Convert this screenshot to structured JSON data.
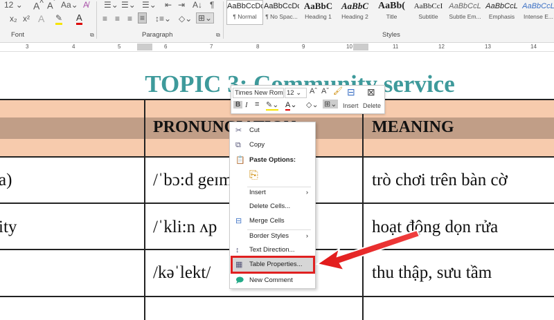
{
  "ribbon": {
    "font_size": "12",
    "groups": {
      "font": "Font",
      "paragraph": "Paragraph",
      "styles": "Styles"
    },
    "styles": [
      {
        "preview": "AaBbCcDc",
        "name": "¶ Normal",
        "selected": true
      },
      {
        "preview": "AaBbCcDc",
        "name": "¶ No Spac..."
      },
      {
        "preview": "AaBbC",
        "name": "Heading 1"
      },
      {
        "preview": "AaBbC",
        "name": "Heading 2"
      },
      {
        "preview": "AaBb(",
        "name": "Title"
      },
      {
        "preview": "AaBbCcI",
        "name": "Subtitle"
      },
      {
        "preview": "AaBbCcL",
        "name": "Subtle Em..."
      },
      {
        "preview": "AaBbCcL",
        "name": "Emphasis"
      },
      {
        "preview": "AaBbCcL",
        "name": "Intense E..."
      }
    ],
    "ruler_ticks": [
      "3",
      "4",
      "5",
      "6",
      "7",
      "8",
      "9",
      "10",
      "11",
      "12",
      "13",
      "14"
    ]
  },
  "document": {
    "title": "TOPIC 3: Community service",
    "headers": [
      "",
      "PRONUNCIATION",
      "MEANING"
    ],
    "rows": [
      [
        "a)",
        "/ˈbɔ:d geɪm/",
        "trò chơi trên bàn cờ"
      ],
      [
        "ity",
        "/ˈkli:n ʌp",
        "hoạt động dọn rửa"
      ],
      [
        "",
        "/kəˈlekt/",
        "thu thập, sưu tầm"
      ]
    ]
  },
  "mini_toolbar": {
    "font": "Times New Rom",
    "size": "12",
    "insert": "Insert",
    "delete": "Delete"
  },
  "context_menu": {
    "cut": "Cut",
    "copy": "Copy",
    "paste_options": "Paste Options:",
    "insert": "Insert",
    "delete_cells": "Delete Cells...",
    "merge_cells": "Merge Cells",
    "border_styles": "Border Styles",
    "text_direction": "Text Direction...",
    "table_properties": "Table Properties...",
    "new_comment": "New Comment"
  },
  "colors": {
    "title": "#3e9a9b",
    "header": "#f7cbad",
    "header_band": "#c19e87",
    "highlight": "#e02020"
  }
}
